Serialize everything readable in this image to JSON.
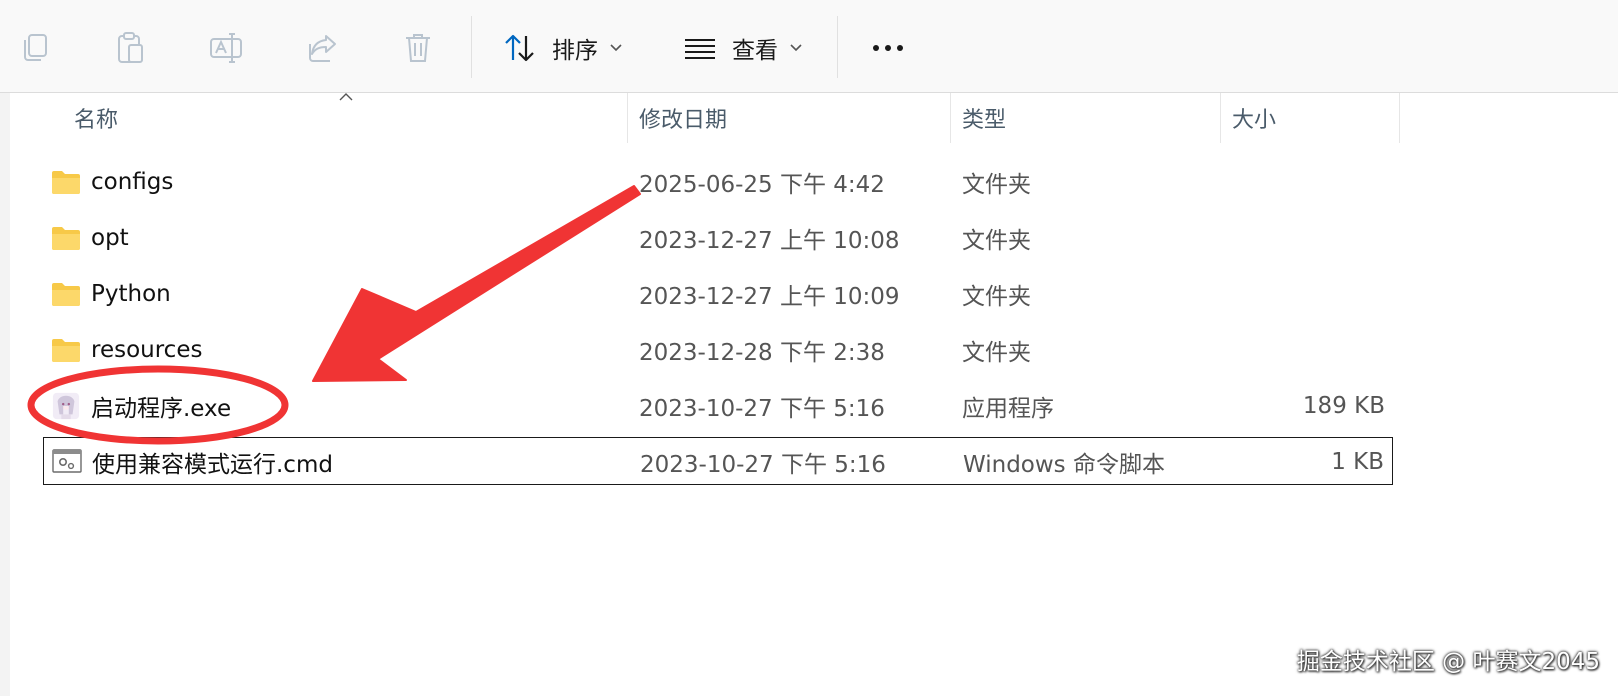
{
  "toolbar": {
    "icons": [
      "copy-icon",
      "paste-icon",
      "rename-icon",
      "share-icon",
      "delete-icon"
    ],
    "sort_label": "排序",
    "view_label": "查看"
  },
  "columns": {
    "name": "名称",
    "date": "修改日期",
    "type": "类型",
    "size": "大小"
  },
  "files": [
    {
      "name": "configs",
      "date": "2025-06-25 下午 4:42",
      "type": "文件夹",
      "size": "",
      "icon": "folder-icon"
    },
    {
      "name": "opt",
      "date": "2023-12-27 上午 10:08",
      "type": "文件夹",
      "size": "",
      "icon": "folder-icon"
    },
    {
      "name": "Python",
      "date": "2023-12-27 上午 10:09",
      "type": "文件夹",
      "size": "",
      "icon": "folder-icon"
    },
    {
      "name": "resources",
      "date": "2023-12-28 下午 2:38",
      "type": "文件夹",
      "size": "",
      "icon": "folder-icon"
    },
    {
      "name": "启动程序.exe",
      "date": "2023-10-27 下午 5:16",
      "type": "应用程序",
      "size": "189 KB",
      "icon": "app-icon"
    },
    {
      "name": "使用兼容模式运行.cmd",
      "date": "2023-10-27 下午 5:16",
      "type": "Windows 命令脚本",
      "size": "1 KB",
      "icon": "cmd-script-icon"
    }
  ],
  "watermark": "掘金技术社区 @ 叶赛文2045",
  "colors": {
    "annotation": "#f03434",
    "folder": "#f7c948",
    "accent": "#0067c0"
  }
}
